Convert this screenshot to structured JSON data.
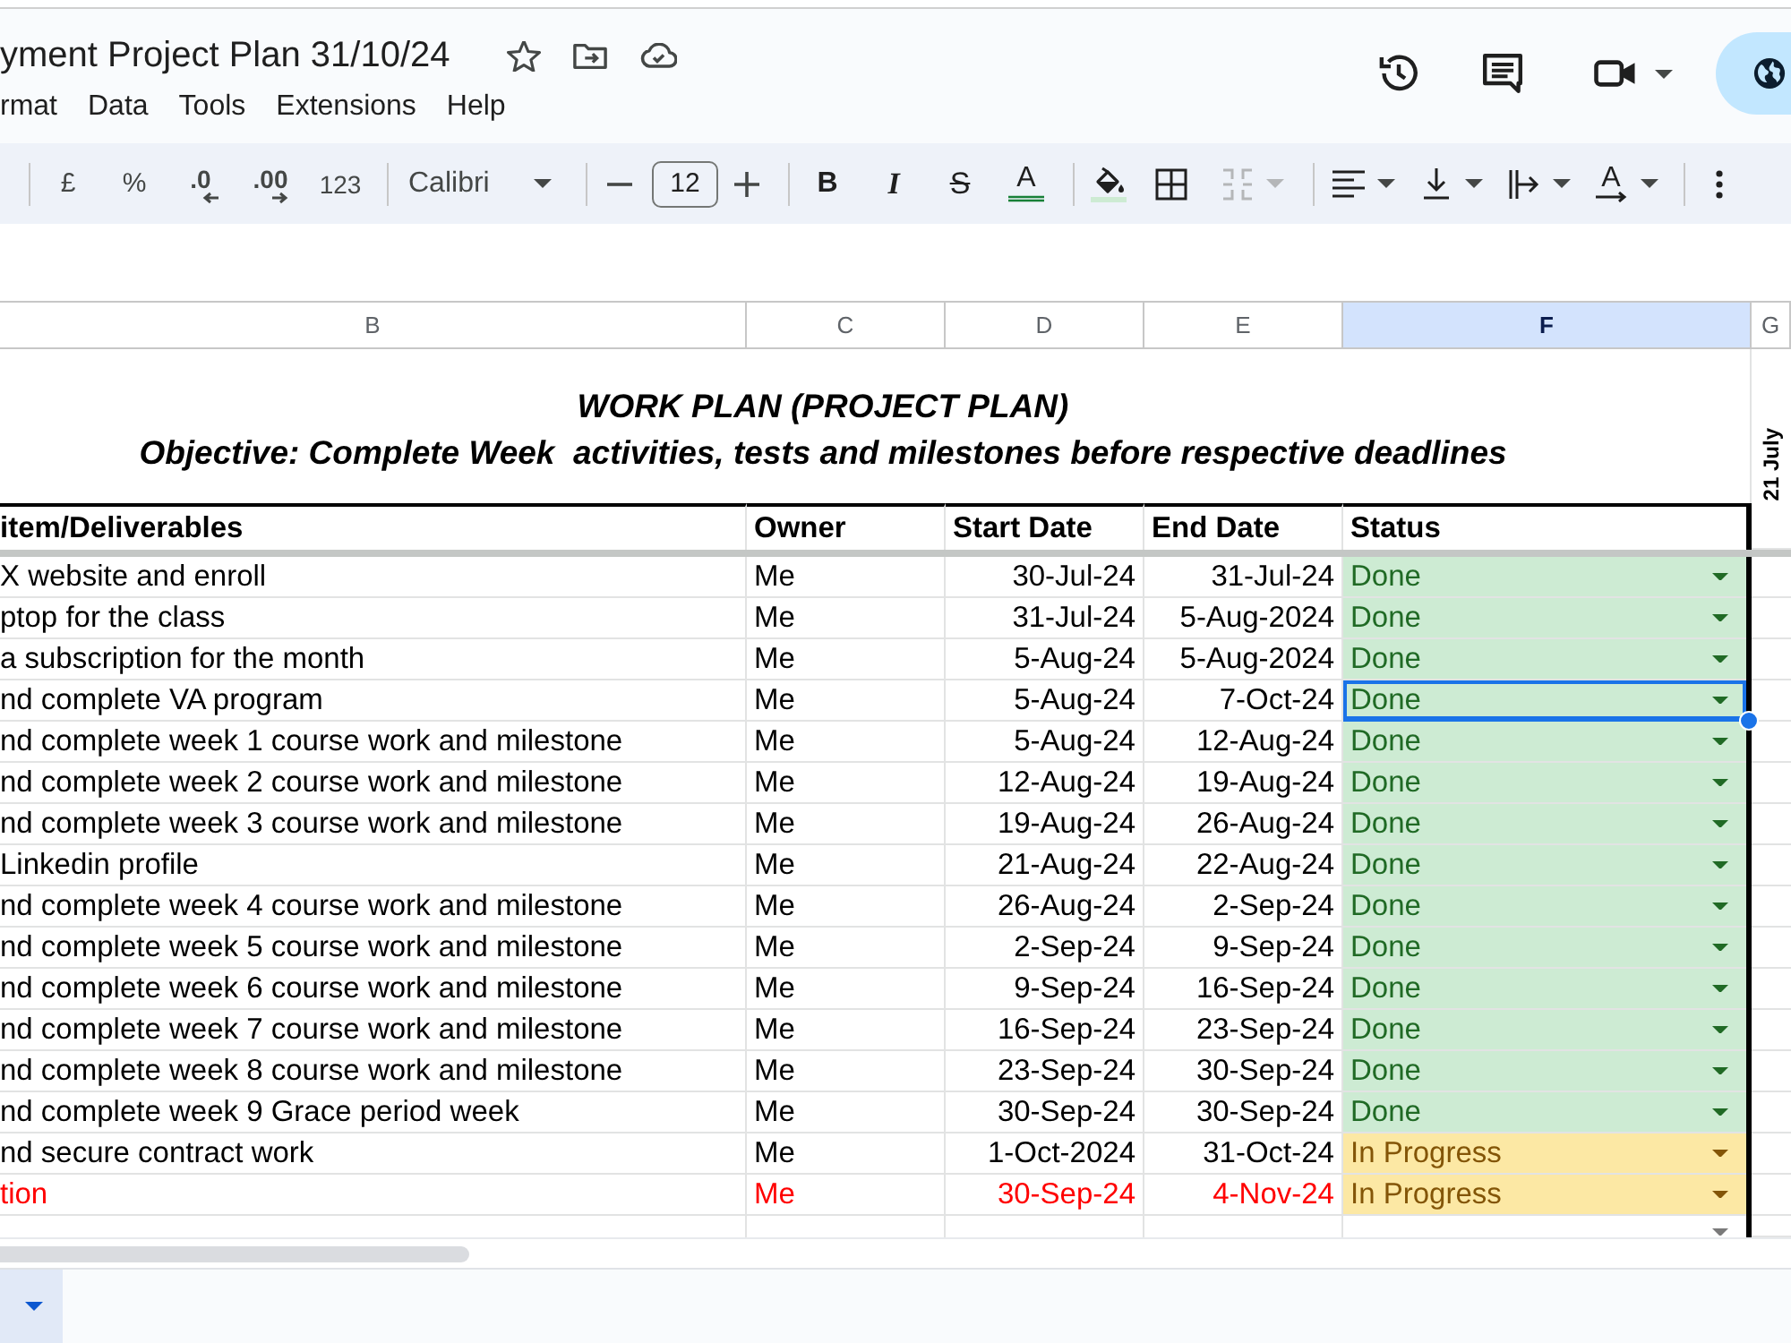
{
  "title_bar": {
    "title": "yment Project Plan 31/10/24",
    "menu": [
      "rmat",
      "Data",
      "Tools",
      "Extensions",
      "Help"
    ]
  },
  "toolbar": {
    "currency": "£",
    "percent": "%",
    "decrease_decimal": ".0",
    "increase_decimal": ".00",
    "number_format": "123",
    "font": "Calibri",
    "font_size": "12",
    "bold": "B",
    "italic": "I",
    "strikethrough": "S",
    "text_color": "A",
    "text_rotation": "A",
    "merge_disabled": true
  },
  "sheet": {
    "columns": [
      {
        "label": "B",
        "selected": false
      },
      {
        "label": "C",
        "selected": false
      },
      {
        "label": "D",
        "selected": false
      },
      {
        "label": "E",
        "selected": false
      },
      {
        "label": "F",
        "selected": true
      },
      {
        "label": "G",
        "selected": false
      }
    ],
    "title": "WORK PLAN (PROJECT PLAN)",
    "objective": "Objective: Complete Week  activities, tests and milestones before respective deadlines",
    "side_label": "21 July",
    "headers": [
      "item/Deliverables",
      "Owner",
      "Start Date",
      "End Date",
      "Status"
    ],
    "rows": [
      {
        "item": "X website and enroll",
        "owner": "Me",
        "start": "30-Jul-24",
        "end": "31-Jul-24",
        "color": "#000000",
        "status": {
          "label": "Done",
          "color": "#cdebd3",
          "selected": false
        }
      },
      {
        "item": "ptop for the class",
        "owner": "Me",
        "start": "31-Jul-24",
        "end": "5-Aug-2024",
        "color": "#000000",
        "status": {
          "label": "Done",
          "color": "#cdebd3",
          "selected": false
        }
      },
      {
        "item": "a subscription for the month",
        "owner": "Me",
        "start": "5-Aug-24",
        "end": "5-Aug-2024",
        "color": "#000000",
        "status": {
          "label": "Done",
          "color": "#cdebd3",
          "selected": false
        }
      },
      {
        "item": "nd complete VA program",
        "owner": "Me",
        "start": "5-Aug-24",
        "end": "7-Oct-24",
        "color": "#000000",
        "status": {
          "label": "Done",
          "color": "#cdebd3",
          "selected": true
        }
      },
      {
        "item": "nd complete week 1 course work and milestone",
        "owner": "Me",
        "start": "5-Aug-24",
        "end": "12-Aug-24",
        "color": "#000000",
        "status": {
          "label": "Done",
          "color": "#cdebd3",
          "selected": false
        }
      },
      {
        "item": "nd complete week 2 course work and milestone",
        "owner": "Me",
        "start": "12-Aug-24",
        "end": "19-Aug-24",
        "color": "#000000",
        "status": {
          "label": "Done",
          "color": "#cdebd3",
          "selected": false
        }
      },
      {
        "item": "nd complete week 3 course work and milestone",
        "owner": "Me",
        "start": "19-Aug-24",
        "end": "26-Aug-24",
        "color": "#000000",
        "status": {
          "label": "Done",
          "color": "#cdebd3",
          "selected": false
        }
      },
      {
        "item": "Linkedin profile",
        "owner": "Me",
        "start": "21-Aug-24",
        "end": "22-Aug-24",
        "color": "#000000",
        "status": {
          "label": "Done",
          "color": "#cdebd3",
          "selected": false
        }
      },
      {
        "item": "nd complete week 4 course work and milestone",
        "owner": "Me",
        "start": "26-Aug-24",
        "end": "2-Sep-24",
        "color": "#000000",
        "status": {
          "label": "Done",
          "color": "#cdebd3",
          "selected": false
        }
      },
      {
        "item": "nd complete week 5 course work and milestone",
        "owner": "Me",
        "start": "2-Sep-24",
        "end": "9-Sep-24",
        "color": "#000000",
        "status": {
          "label": "Done",
          "color": "#cdebd3",
          "selected": false
        }
      },
      {
        "item": "nd complete week 6 course work and milestone",
        "owner": "Me",
        "start": "9-Sep-24",
        "end": "16-Sep-24",
        "color": "#000000",
        "status": {
          "label": "Done",
          "color": "#cdebd3",
          "selected": false
        }
      },
      {
        "item": "nd complete week 7 course work and milestone",
        "owner": "Me",
        "start": "16-Sep-24",
        "end": "23-Sep-24",
        "color": "#000000",
        "status": {
          "label": "Done",
          "color": "#cdebd3",
          "selected": false
        }
      },
      {
        "item": "nd complete week 8 course work and milestone",
        "owner": "Me",
        "start": "23-Sep-24",
        "end": "30-Sep-24",
        "color": "#000000",
        "status": {
          "label": "Done",
          "color": "#cdebd3",
          "selected": false
        }
      },
      {
        "item": "nd complete week 9 Grace period week",
        "owner": "Me",
        "start": "30-Sep-24",
        "end": "30-Sep-24",
        "color": "#000000",
        "status": {
          "label": "Done",
          "color": "#cdebd3",
          "selected": false
        }
      },
      {
        "item": "nd secure contract work",
        "owner": "Me",
        "start": "1-Oct-2024",
        "end": "31-Oct-24",
        "color": "#000000",
        "status": {
          "label": "In Progress",
          "color": "#fce8a4",
          "selected": false
        }
      },
      {
        "item": "tion",
        "owner": "Me",
        "start": "30-Sep-24",
        "end": "4-Nov-24",
        "color": "#ff0000",
        "status": {
          "label": "In Progress",
          "color": "#fce8a4",
          "selected": false
        }
      }
    ],
    "next_row_dropdown": true
  }
}
